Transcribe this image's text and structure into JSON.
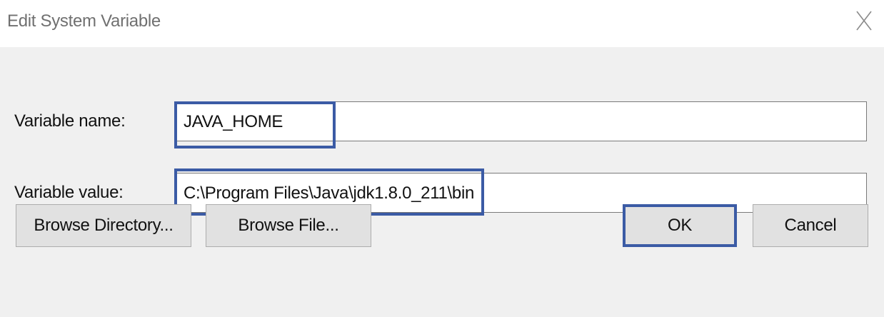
{
  "window": {
    "title": "Edit System Variable"
  },
  "fields": {
    "name_label": "Variable name:",
    "name_value": "JAVA_HOME",
    "value_label": "Variable value:",
    "value_value": "C:\\Program Files\\Java\\jdk1.8.0_211\\bin"
  },
  "buttons": {
    "browse_directory": "Browse Directory...",
    "browse_file": "Browse File...",
    "ok": "OK",
    "cancel": "Cancel"
  },
  "icons": {
    "close": "close-icon"
  },
  "colors": {
    "highlight": "#3b5ba5",
    "body_bg": "#f0f0f0",
    "button_bg": "#e1e1e1",
    "title_text": "#707070"
  }
}
